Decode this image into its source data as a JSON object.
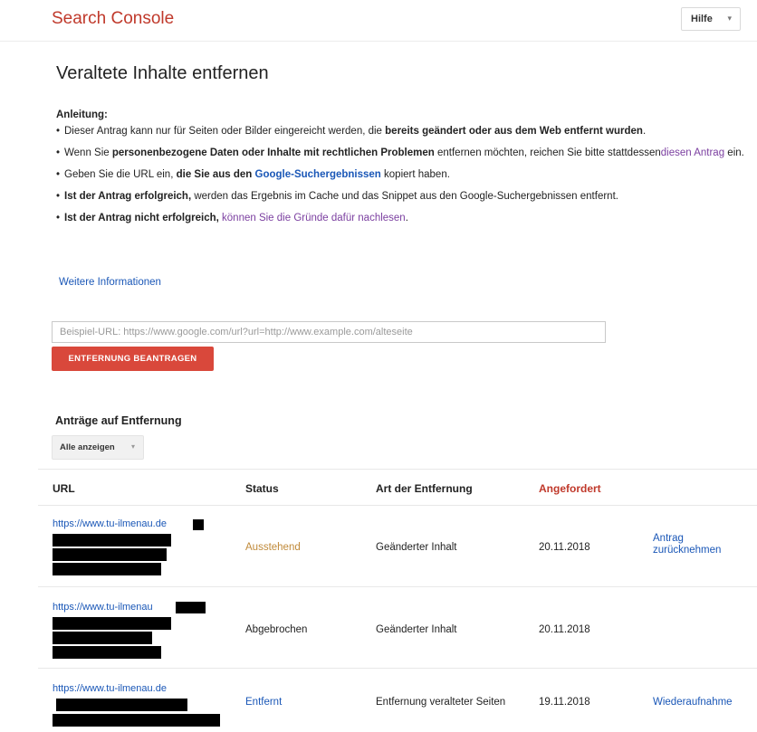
{
  "header": {
    "brand": "Search Console",
    "help_label": "Hilfe",
    "help_chevron": "▾"
  },
  "page_title": "Veraltete Inhalte entfernen",
  "instructions": {
    "heading": "Anleitung:",
    "items": [
      [
        "Dieser Antrag kann nur für Seiten oder Bilder eingereicht werden, die ",
        "bereits geändert oder aus dem Web entfernt wurden",
        "."
      ],
      [
        "Wenn Sie ",
        "personenbezogene Daten oder Inhalte mit rechtlichen Problemen",
        " entfernen möchten, reichen Sie bitte stattdessen",
        "diesen Antrag",
        " ein."
      ],
      [
        "Geben Sie die URL ein, ",
        "die Sie aus den ",
        "Google-Suchergebnissen",
        " kopiert haben."
      ],
      [
        "Ist der Antrag erfolgreich,",
        " werden das Ergebnis im Cache und das Snippet aus den Google-Suchergebnissen entfernt."
      ],
      [
        "Ist der Antrag nicht erfolgreich,",
        " ",
        "können Sie die Gründe dafür nachlesen",
        "."
      ]
    ]
  },
  "more_info": "Weitere Informationen",
  "url_input": {
    "placeholder": "Beispiel-URL: https://www.google.com/url?url=http://www.example.com/alteseite",
    "value": ""
  },
  "submit_label": "ENTFERNUNG BEANTRAGEN",
  "requests": {
    "title": "Anträge auf Entfernung",
    "filter_label": "Alle anzeigen",
    "filter_chevron": "▾",
    "columns": [
      "URL",
      "Status",
      "Art der Entfernung",
      "Angefordert"
    ],
    "rows": [
      {
        "url": "https://www.tu-ilmenau.de",
        "status": "Ausstehend",
        "type": "Geänderter Inhalt",
        "date": "20.11.2018",
        "action": "Antrag zurücknehmen"
      },
      {
        "url": "https://www.tu-ilmenau",
        "status": "Abgebrochen",
        "type": "Geänderter Inhalt",
        "date": "20.11.2018",
        "action": ""
      },
      {
        "url": "https://www.tu-ilmenau.de",
        "status": "Entfernt",
        "type": "Entfernung veralteter Seiten",
        "date": "19.11.2018",
        "action": "Wiederaufnahme"
      }
    ]
  },
  "colors": {
    "brand": "#c0392b",
    "accent_button": "#d9483b",
    "link": "#1a57b7",
    "visited_link": "#7b3fa0",
    "pending": "#c08a3a"
  }
}
